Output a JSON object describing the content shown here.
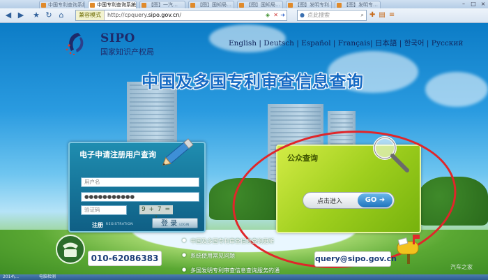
{
  "browser": {
    "tabs": [
      {
        "label": "中国专利查询系统",
        "active": false
      },
      {
        "label": "中国专利查询系统",
        "active": true
      },
      {
        "label": "【图】一汽…",
        "active": false
      },
      {
        "label": "【图】国知局…",
        "active": false
      },
      {
        "label": "【图】国知局…",
        "active": false
      },
      {
        "label": "【图】发明专利…",
        "active": false
      },
      {
        "label": "【图】发明专…",
        "active": false
      }
    ],
    "address_mode": "兼容模式",
    "address_url_prefix": "http://cpquery.",
    "address_url_domain": "sipo.gov.cn",
    "address_url_suffix": "/",
    "search_placeholder": "点此搜索"
  },
  "logo": {
    "name": "SIPO",
    "subtitle": "国家知识产权局"
  },
  "languages": "English | Deutsch | Español | Français| 日本語 | 한국어 | Русский",
  "headline": "中国及多国专利审查信息查询",
  "login_panel": {
    "title": "电子申请注册用户查询",
    "username_placeholder": "用户名",
    "password_value": "●●●●●●●●●●●",
    "captcha_placeholder": "验证码",
    "captcha_text": "9 + 7 = ?",
    "register_label": "注册",
    "register_en": "REGISTRATION",
    "login_label": "登 录",
    "login_en": "LOGIN"
  },
  "public_panel": {
    "title": "公众查询",
    "enter_label": "点击进入",
    "go_label": "GO"
  },
  "footer": {
    "phone": "010-62086383",
    "email": "query@sipo.gov.cn",
    "news": [
      "中国及多国专利审查信息查询更新",
      "系统使用常见问题",
      "多国发明专利审查信息查询服务的通"
    ]
  },
  "watermark": "汽车之家",
  "taskbar": [
    "2014\\...",
    "电脑检测"
  ],
  "colors": {
    "annotation": "#e0262a",
    "headline": "#1469c4",
    "login_panel": "#1f8db0",
    "public_panel": "#9fcf1e"
  }
}
